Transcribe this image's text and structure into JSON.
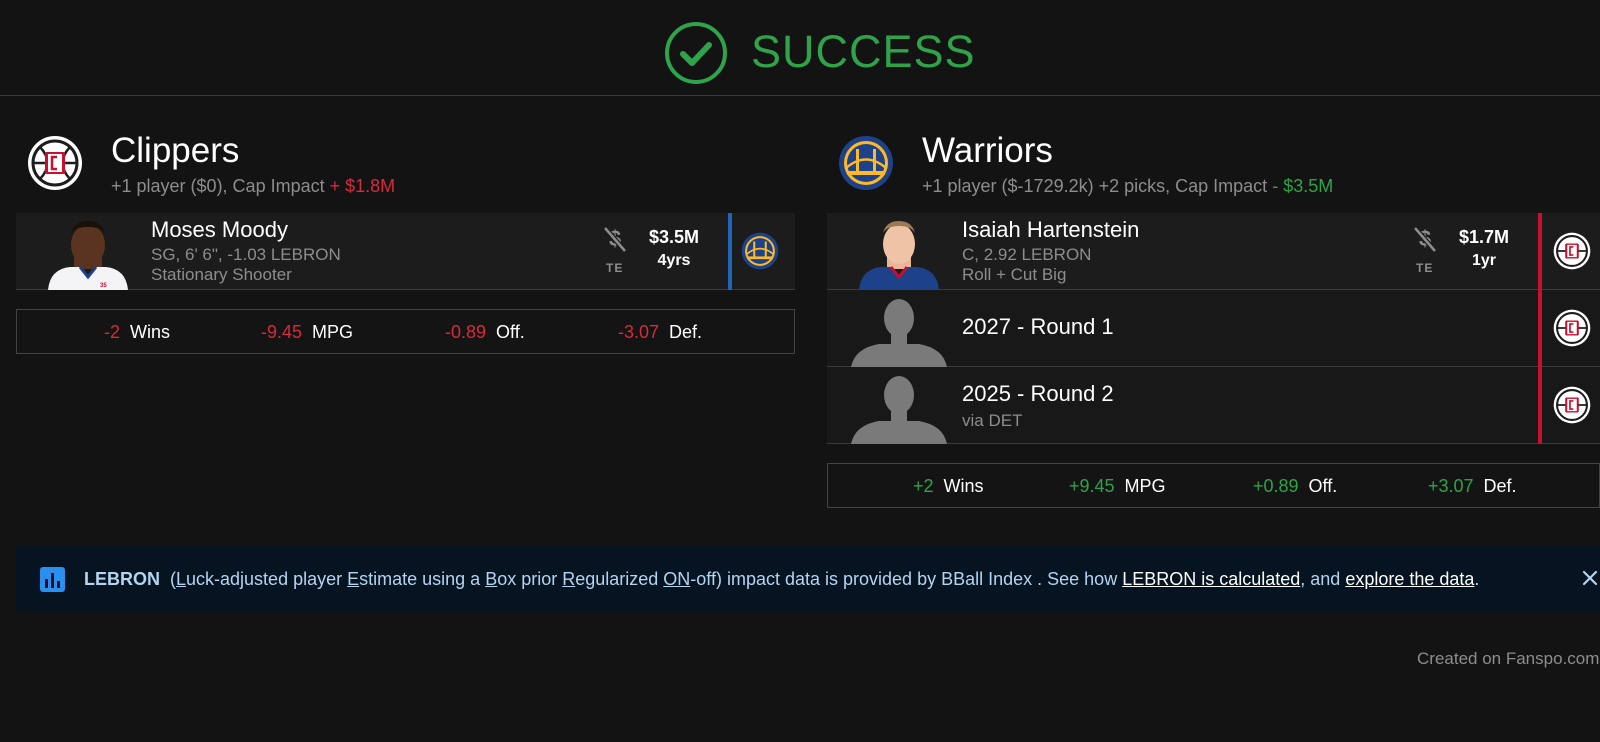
{
  "status": {
    "label": "SUCCESS",
    "color": "#2ea34a"
  },
  "left_team": {
    "name": "Clippers",
    "summary": "+1 player ($0), Cap Impact",
    "cap_impact": "+ $1.8M",
    "logo": "clippers-logo",
    "player": {
      "name": "Moses Moody",
      "line1": "SG, 6' 6\", -1.03 LEBRON",
      "line2": "Stationary Shooter",
      "te_label": "TE",
      "salary": "$3.5M",
      "years": "4yrs",
      "from_logo": "warriors-logo"
    },
    "stats": [
      {
        "value": "-2",
        "label": "Wins"
      },
      {
        "value": "-9.45",
        "label": "MPG"
      },
      {
        "value": "-0.89",
        "label": "Off."
      },
      {
        "value": "-3.07",
        "label": "Def."
      }
    ]
  },
  "right_team": {
    "name": "Warriors",
    "summary": "+1 player ($-1729.2k) +2 picks, Cap Impact",
    "cap_impact": "- $3.5M",
    "logo": "warriors-logo",
    "player": {
      "name": "Isaiah Hartenstein",
      "line1": "C, 2.92 LEBRON",
      "line2": "Roll + Cut Big",
      "te_label": "TE",
      "salary": "$1.7M",
      "years": "1yr",
      "from_logo": "clippers-logo"
    },
    "picks": [
      {
        "title": "2027 - Round 1",
        "note": ""
      },
      {
        "title": "2025 - Round 2",
        "note": "via DET"
      }
    ],
    "stats": [
      {
        "value": "+2",
        "label": "Wins"
      },
      {
        "value": "+9.45",
        "label": "MPG"
      },
      {
        "value": "+0.89",
        "label": "Off."
      },
      {
        "value": "+3.07",
        "label": "Def."
      }
    ]
  },
  "banner": {
    "icon": "bar-chart-icon",
    "lebron": "LEBRON",
    "p1": "(",
    "L": "L",
    "p2": "uck-adjusted player ",
    "E": "E",
    "p3": "stimate using a ",
    "B": "B",
    "p4": "ox prior ",
    "R": "R",
    "p5": "egularized ",
    "ON": "ON",
    "p6": "-off) impact data is provided by BBall Index . See how ",
    "link1": "LEBRON is calculated",
    "p7": ", and ",
    "link2": "explore the data",
    "p8": "."
  },
  "footer": "Created on Fanspo.com"
}
